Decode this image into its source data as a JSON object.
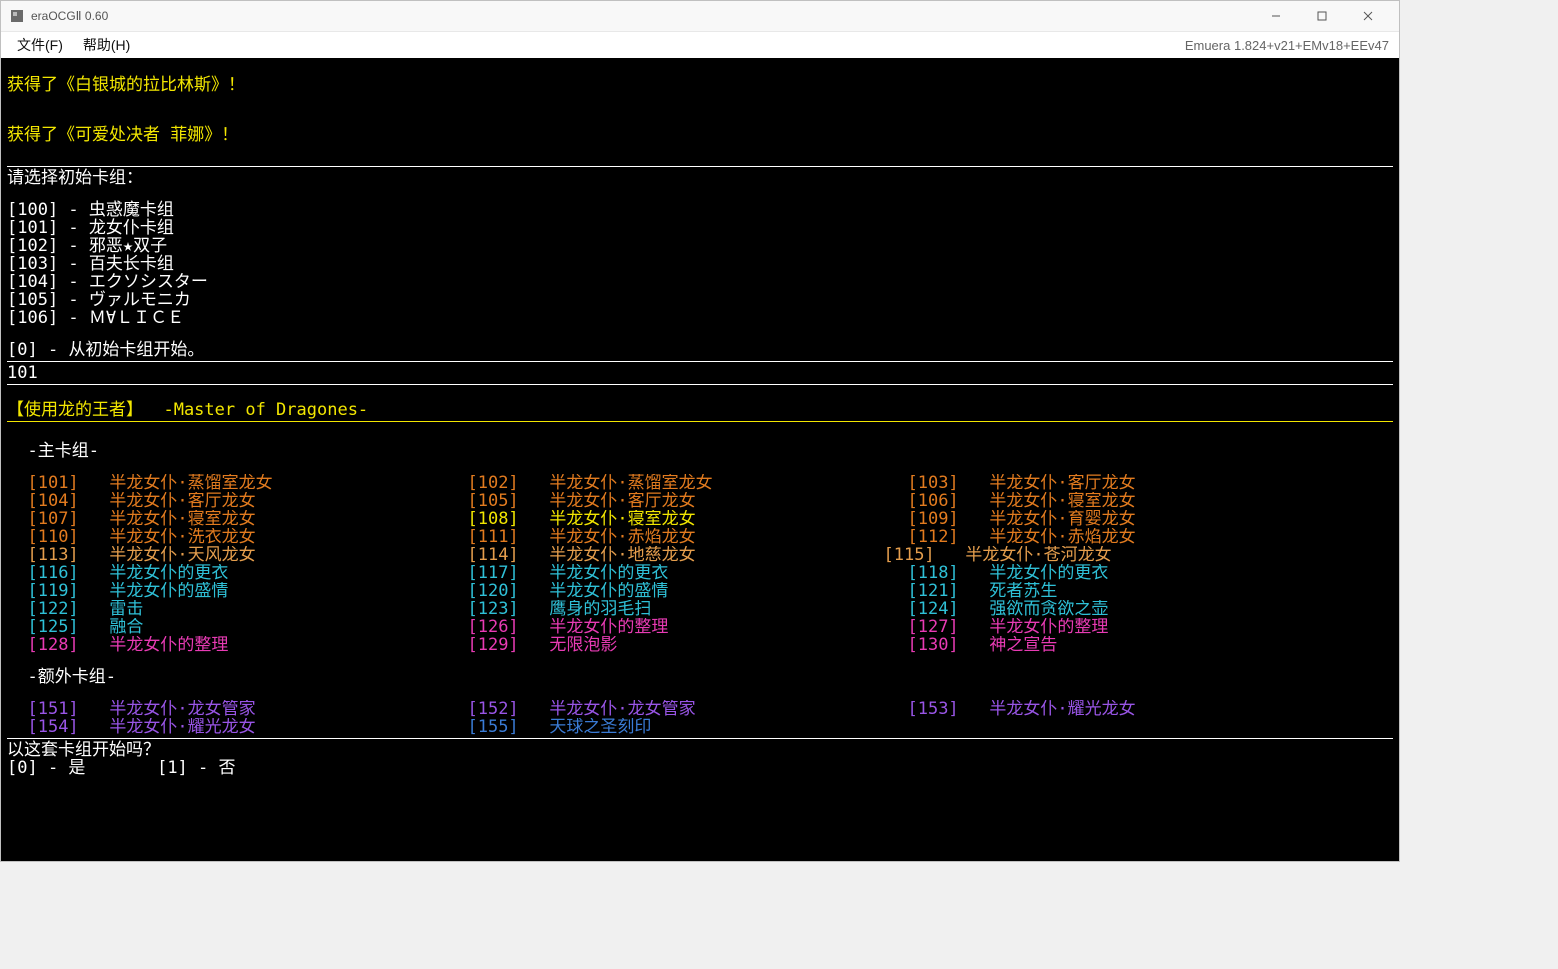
{
  "title": "eraOCGⅡ 0.60",
  "menu": {
    "file": "文件(F)",
    "help": "帮助(H)"
  },
  "version": "Emuera 1.824+v21+EMv18+EEv47",
  "msg": {
    "got1": "获得了《白银城的拉比林斯》！",
    "got2": "获得了《可爱处决者 菲娜》！",
    "prompt_deck": "请选择初始卡组：",
    "input": "101",
    "title_line": "【使用龙的王者】  -Master of Dragones-",
    "main_deck": "-主卡组-",
    "extra_deck": "-额外卡组-",
    "confirm": "以这套卡组开始吗？",
    "yes": "[0] - 是",
    "no": "[1] - 否"
  },
  "starters": [
    {
      "id": "[100]",
      "sep": " - ",
      "name": "虫惑魔卡组"
    },
    {
      "id": "[101]",
      "sep": " - ",
      "name": "龙女仆卡组"
    },
    {
      "id": "[102]",
      "sep": " - ",
      "name": "邪恶★双子"
    },
    {
      "id": "[103]",
      "sep": " - ",
      "name": "百夫长卡组"
    },
    {
      "id": "[104]",
      "sep": " - ",
      "name": "エクソシスター"
    },
    {
      "id": "[105]",
      "sep": " - ",
      "name": "ヴァルモニカ"
    },
    {
      "id": "[106]",
      "sep": " - ",
      "name": "Ｍ∀ＬＩＣＥ"
    }
  ],
  "start_option": {
    "id": "[0]",
    "sep": " - ",
    "name": "从初始卡组开始。"
  },
  "main": [
    [
      {
        "c": "o",
        "id": "[101]",
        "name": "半龙女仆·蒸馏室龙女"
      },
      {
        "c": "o",
        "id": "[102]",
        "name": "半龙女仆·蒸馏室龙女"
      },
      {
        "c": "o",
        "id": "[103]",
        "name": "半龙女仆·客厅龙女"
      }
    ],
    [
      {
        "c": "o",
        "id": "[104]",
        "name": "半龙女仆·客厅龙女"
      },
      {
        "c": "o",
        "id": "[105]",
        "name": "半龙女仆·客厅龙女"
      },
      {
        "c": "o",
        "id": "[106]",
        "name": "半龙女仆·寝室龙女"
      }
    ],
    [
      {
        "c": "o",
        "id": "[107]",
        "name": "半龙女仆·寝室龙女"
      },
      {
        "c": "y",
        "id": "[108]",
        "name": "半龙女仆·寝室龙女"
      },
      {
        "c": "o",
        "id": "[109]",
        "name": "半龙女仆·育婴龙女"
      }
    ],
    [
      {
        "c": "o",
        "id": "[110]",
        "name": "半龙女仆·洗衣龙女"
      },
      {
        "c": "o",
        "id": "[111]",
        "name": "半龙女仆·赤焰龙女"
      },
      {
        "c": "o",
        "id": "[112]",
        "name": "半龙女仆·赤焰龙女"
      }
    ],
    [
      {
        "c": "o2",
        "id": "[113]",
        "name": "半龙女仆·天风龙女"
      },
      {
        "c": "o2",
        "id": "[114]",
        "name": "半龙女仆·地慈龙女"
      },
      {
        "c": "o2",
        "id": "[115]",
        "name": "半龙女仆·苍河龙女",
        "shift": -3
      }
    ],
    [
      {
        "c": "c",
        "id": "[116]",
        "name": "半龙女仆的更衣"
      },
      {
        "c": "c",
        "id": "[117]",
        "name": "半龙女仆的更衣"
      },
      {
        "c": "c",
        "id": "[118]",
        "name": "半龙女仆的更衣"
      }
    ],
    [
      {
        "c": "c",
        "id": "[119]",
        "name": "半龙女仆的盛情"
      },
      {
        "c": "c",
        "id": "[120]",
        "name": "半龙女仆的盛情"
      },
      {
        "c": "c",
        "id": "[121]",
        "name": "死者苏生"
      }
    ],
    [
      {
        "c": "c",
        "id": "[122]",
        "name": "雷击"
      },
      {
        "c": "c",
        "id": "[123]",
        "name": "鹰身的羽毛扫"
      },
      {
        "c": "c",
        "id": "[124]",
        "name": "强欲而贪欲之壶"
      }
    ],
    [
      {
        "c": "c",
        "id": "[125]",
        "name": "融合"
      },
      {
        "c": "m",
        "id": "[126]",
        "name": "半龙女仆的整理"
      },
      {
        "c": "m",
        "id": "[127]",
        "name": "半龙女仆的整理"
      }
    ],
    [
      {
        "c": "m",
        "id": "[128]",
        "name": "半龙女仆的整理"
      },
      {
        "c": "m",
        "id": "[129]",
        "name": "无限泡影"
      },
      {
        "c": "m",
        "id": "[130]",
        "name": "神之宣告"
      }
    ]
  ],
  "extra": [
    [
      {
        "c": "p",
        "id": "[151]",
        "name": "半龙女仆·龙女管家"
      },
      {
        "c": "p",
        "id": "[152]",
        "name": "半龙女仆·龙女管家"
      },
      {
        "c": "p",
        "id": "[153]",
        "name": "半龙女仆·耀光龙女"
      }
    ],
    [
      {
        "c": "p",
        "id": "[154]",
        "name": "半龙女仆·耀光龙女"
      },
      {
        "c": "b",
        "id": "[155]",
        "name": "天球之圣刻印"
      },
      null
    ]
  ]
}
